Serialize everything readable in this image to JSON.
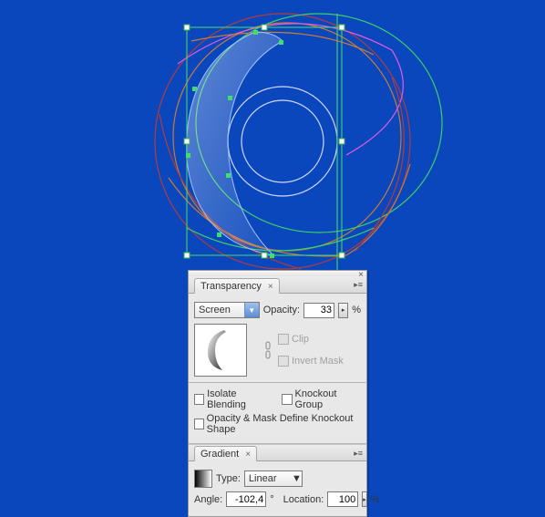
{
  "panel": {
    "tabs": {
      "transparency": "Transparency",
      "gradient": "Gradient"
    },
    "transparency": {
      "blend_mode": "Screen",
      "opacity_label": "Opacity:",
      "opacity_value": "33",
      "opacity_pct": "%",
      "clip_label": "Clip",
      "invert_label": "Invert Mask",
      "isolate": "Isolate Blending",
      "knockout": "Knockout Group",
      "mask_define": "Opacity & Mask Define Knockout Shape"
    },
    "gradient": {
      "type_label": "Type:",
      "type_value": "Linear",
      "angle_label": "Angle:",
      "angle_value": "-102,4",
      "angle_deg": "°",
      "location_label": "Location:",
      "location_value": "100",
      "location_pct": "%"
    }
  }
}
